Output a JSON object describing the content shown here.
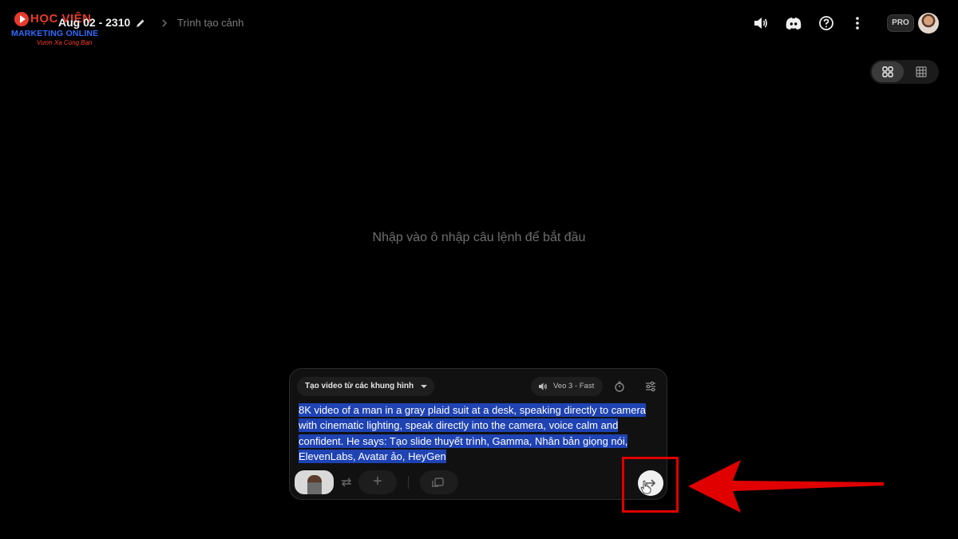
{
  "logo": {
    "line1": "HỌC VIỆN",
    "line2": "MARKETING ONLINE",
    "tagline": "Vươn Xa Cùng Bạn"
  },
  "header": {
    "project_title": "Aug 02 - 2310",
    "breadcrumb": "Trình tạo cảnh",
    "pro_badge": "PRO"
  },
  "main": {
    "empty_hint": "Nhập vào ô nhập câu lệnh để bắt đầu"
  },
  "composer": {
    "mode_label": "Tạo video từ các khung hình",
    "model_label": "Veo 3 - Fast",
    "prompt_text": "8K video of a man in a gray plaid suit at a desk, speaking directly to camera with cinematic lighting, speak directly into the camera, voice calm and confident. He says: Tạo slide thuyết trình, Gamma, Nhân bản giọng nói, ElevenLabs, Avatar ảo, HeyGen",
    "add_label": "+"
  },
  "colors": {
    "background": "#000000",
    "selection": "#1f43b3",
    "annotation": "#e00000",
    "logo_red": "#e8392b",
    "logo_blue": "#2f6bff"
  }
}
